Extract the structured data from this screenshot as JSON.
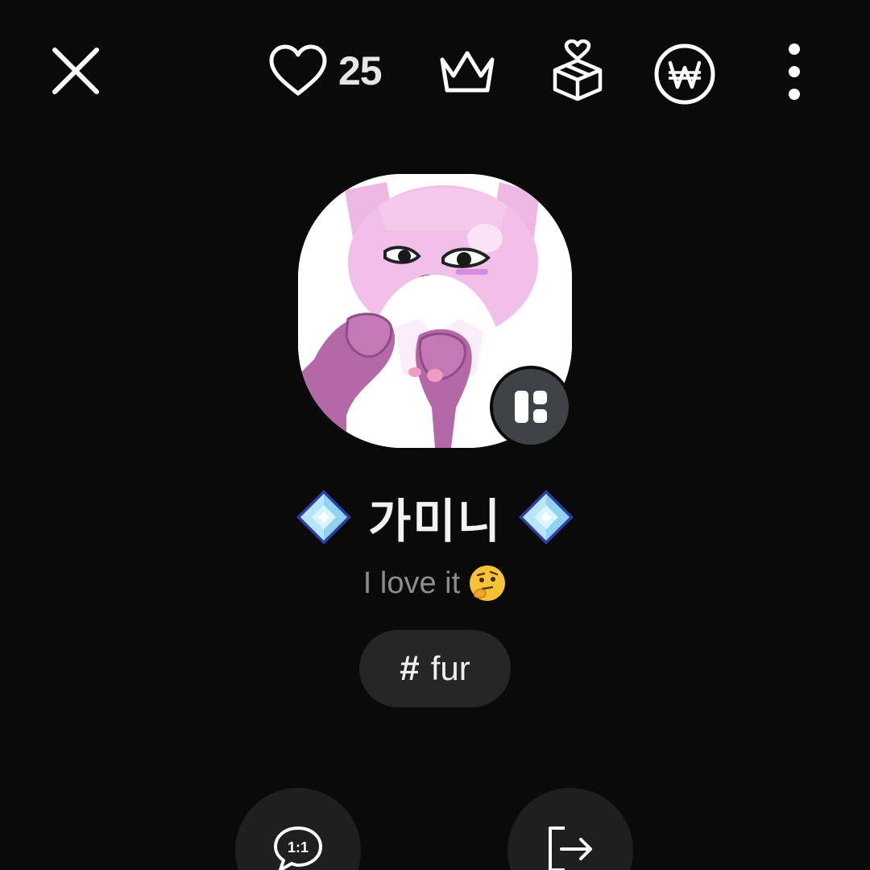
{
  "header": {
    "like_count": "25"
  },
  "icons": {
    "close": "close-icon",
    "like": "heart-outline-icon",
    "crown": "crown-icon",
    "gift": "gift-box-heart-icon",
    "currency": "won-coin-icon",
    "more": "more-vertical-icon",
    "profile_badge": "profile-layout-icon",
    "diamond": "diamond-gem-icon",
    "thinking": "thinking-face-emoji",
    "tag": "hashtag-icon",
    "chat": "one-to-one-chat-icon",
    "exit": "exit-icon"
  },
  "profile": {
    "name": "가미니",
    "status": "I love it",
    "tag": "fur"
  },
  "actions": {
    "chat_glyph": "1:1"
  },
  "colors": {
    "background": "#0a0a0a",
    "chip": "#262626",
    "action_bg": "#1f1f1f",
    "badge_bg": "#3f4347",
    "muted_text": "#8c8c8c"
  }
}
